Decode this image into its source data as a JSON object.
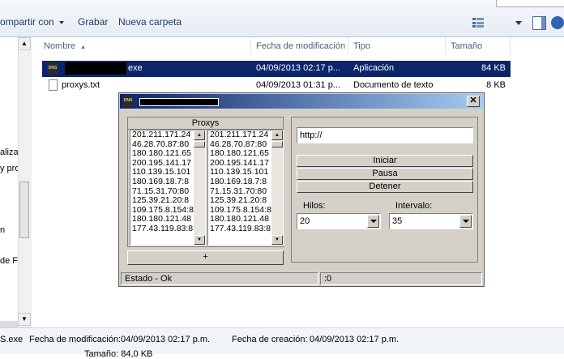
{
  "toolbar": {
    "share_label": "ompartir con",
    "burn_label": "Grabar",
    "new_folder_label": "Nueva carpeta"
  },
  "nav": {
    "fragments": [
      "aliza",
      "y pro",
      "n",
      "de F"
    ]
  },
  "columns": {
    "name": "Nombre",
    "modified": "Fecha de modificación",
    "type": "Tipo",
    "size": "Tamaño"
  },
  "files": [
    {
      "name": "exe",
      "modified": "04/09/2013 02:17 p...",
      "type": "Aplicación",
      "size": "84 KB",
      "icon": "app-icon",
      "selected": true
    },
    {
      "name": "proxys.txt",
      "modified": "04/09/2013 01:31 p...",
      "type": "Documento de texto",
      "size": "8 KB",
      "icon": "text-file-icon",
      "selected": false
    }
  ],
  "dialog": {
    "app_icon_text": "DNS",
    "proxies_title": "Proxys",
    "proxies_a": [
      "201.211.171.24",
      "46.28.70.87:80",
      "180.180.121.65",
      "200.195.141.17",
      "110.139.15.101",
      "180.169.18.7:8",
      "71.15.31.70:80",
      "125.39.21.20:8",
      "109.175.8.154:8",
      "180.180.121.48",
      "177.43.119.83:8"
    ],
    "proxies_b": [
      "201.211.171.24",
      "46.28.70.87:80",
      "180.180.121.65",
      "200.195.141.17",
      "110.139.15.101",
      "180.169.18.7:8",
      "71.15.31.70:80",
      "125.39.21.20:8",
      "109.175.8.154:8",
      "180.180.121.48",
      "177.43.119.83:8"
    ],
    "add_label": "+",
    "url_value": "http://",
    "start_label": "Iniciar",
    "pause_label": "Pausa",
    "stop_label": "Detener",
    "threads_label": "Hilos:",
    "threads_value": "20",
    "interval_label": "Intervalo:",
    "interval_value": "35",
    "status_text": "Estado - Ok",
    "count_text": ":0"
  },
  "details": {
    "file_suffix": "S.exe",
    "modified_label": "Fecha de modificación:",
    "modified_value": "04/09/2013 02:17 p.m.",
    "created_label": "Fecha de creación:",
    "created_value": "04/09/2013 02:17 p.m.",
    "size_partial": "Tamaño: 84,0 KB"
  },
  "colors": {
    "selection": "#0b246a",
    "title_start": "#0a246a",
    "title_end": "#a6caf0",
    "dialog_face": "#d4d0c8"
  }
}
